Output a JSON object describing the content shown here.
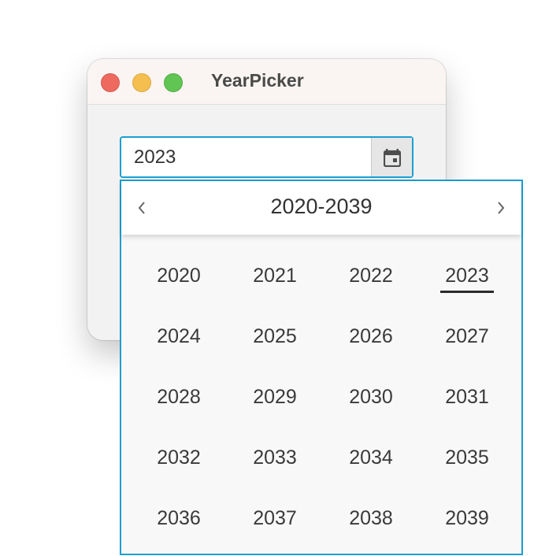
{
  "window": {
    "title": "YearPicker",
    "controls": [
      "close",
      "minimize",
      "maximize"
    ]
  },
  "year_input": {
    "value": "2023",
    "calendar_icon": "calendar-icon"
  },
  "popup": {
    "range_label": "2020-2039",
    "prev_icon": "chevron-left-icon",
    "next_icon": "chevron-right-icon",
    "selected_year": "2023",
    "years": [
      "2020",
      "2021",
      "2022",
      "2023",
      "2024",
      "2025",
      "2026",
      "2027",
      "2028",
      "2029",
      "2030",
      "2031",
      "2032",
      "2033",
      "2034",
      "2035",
      "2036",
      "2037",
      "2038",
      "2039"
    ]
  },
  "colors": {
    "accent": "#1a9fd1",
    "close": "#ee6a5f",
    "minimize": "#f5bf4f",
    "maximize": "#61c554"
  }
}
